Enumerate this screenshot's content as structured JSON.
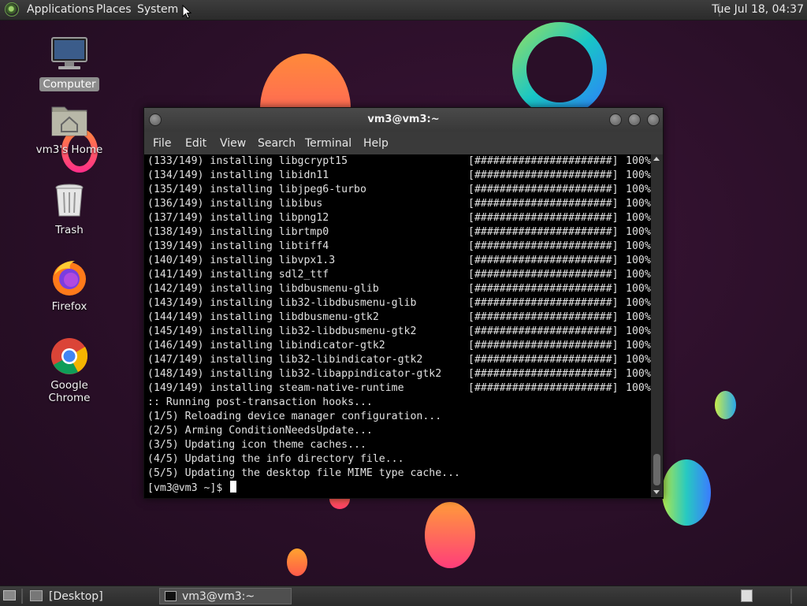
{
  "top_panel": {
    "menus": [
      "Applications",
      "Places",
      "System"
    ],
    "clock": "Tue Jul 18, 04:37"
  },
  "desktop_icons": {
    "computer": "Computer",
    "home": "vm3's Home",
    "trash": "Trash",
    "firefox": "Firefox",
    "chrome": "Google Chrome"
  },
  "terminal": {
    "title": "vm3@vm3:~",
    "menu": [
      "File",
      "Edit",
      "View",
      "Search",
      "Terminal",
      "Help"
    ],
    "install_lines": [
      {
        "text": "(133/149) installing libgcrypt15",
        "bar": "[######################]",
        "pct": "100%"
      },
      {
        "text": "(134/149) installing libidn11",
        "bar": "[######################]",
        "pct": "100%"
      },
      {
        "text": "(135/149) installing libjpeg6-turbo",
        "bar": "[######################]",
        "pct": "100%"
      },
      {
        "text": "(136/149) installing libibus",
        "bar": "[######################]",
        "pct": "100%"
      },
      {
        "text": "(137/149) installing libpng12",
        "bar": "[######################]",
        "pct": "100%"
      },
      {
        "text": "(138/149) installing librtmp0",
        "bar": "[######################]",
        "pct": "100%"
      },
      {
        "text": "(139/149) installing libtiff4",
        "bar": "[######################]",
        "pct": "100%"
      },
      {
        "text": "(140/149) installing libvpx1.3",
        "bar": "[######################]",
        "pct": "100%"
      },
      {
        "text": "(141/149) installing sdl2_ttf",
        "bar": "[######################]",
        "pct": "100%"
      },
      {
        "text": "(142/149) installing libdbusmenu-glib",
        "bar": "[######################]",
        "pct": "100%"
      },
      {
        "text": "(143/149) installing lib32-libdbusmenu-glib",
        "bar": "[######################]",
        "pct": "100%"
      },
      {
        "text": "(144/149) installing libdbusmenu-gtk2",
        "bar": "[######################]",
        "pct": "100%"
      },
      {
        "text": "(145/149) installing lib32-libdbusmenu-gtk2",
        "bar": "[######################]",
        "pct": "100%"
      },
      {
        "text": "(146/149) installing libindicator-gtk2",
        "bar": "[######################]",
        "pct": "100%"
      },
      {
        "text": "(147/149) installing lib32-libindicator-gtk2",
        "bar": "[######################]",
        "pct": "100%"
      },
      {
        "text": "(148/149) installing lib32-libappindicator-gtk2",
        "bar": "[######################]",
        "pct": "100%"
      },
      {
        "text": "(149/149) installing steam-native-runtime",
        "bar": "[######################]",
        "pct": "100%"
      }
    ],
    "hook_lines": [
      ":: Running post-transaction hooks...",
      "(1/5) Reloading device manager configuration...",
      "(2/5) Arming ConditionNeedsUpdate...",
      "(3/5) Updating icon theme caches...",
      "(4/5) Updating the info directory file...",
      "(5/5) Updating the desktop file MIME type cache..."
    ],
    "prompt": "[vm3@vm3 ~]$ "
  },
  "taskbar": {
    "desktop_label": "[Desktop]",
    "terminal_label": "vm3@vm3:~"
  },
  "colors": {
    "panel": "#333333",
    "terminal_bg": "#000000",
    "terminal_fg": "#e0e0e0",
    "wallpaper": "#2a0f28"
  }
}
